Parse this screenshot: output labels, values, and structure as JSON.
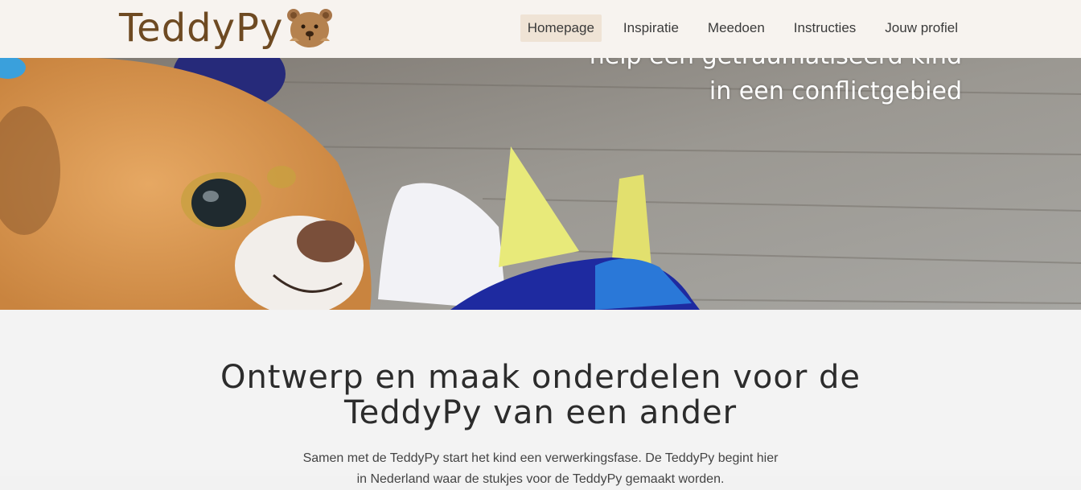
{
  "header": {
    "logo_text": "TeddyPy",
    "nav": [
      {
        "label": "Homepage",
        "active": true
      },
      {
        "label": "Inspiratie",
        "active": false
      },
      {
        "label": "Meedoen",
        "active": false
      },
      {
        "label": "Instructies",
        "active": false
      },
      {
        "label": "Jouw profiel",
        "active": false
      }
    ]
  },
  "hero": {
    "caption_line1": "help een getraumatiseerd kind",
    "caption_line2": "in een conflictgebied"
  },
  "main": {
    "title": "Ontwerp en maak onderdelen voor de TeddyPy van een ander",
    "intro": "Samen met de TeddyPy start het kind een verwerkingsfase. De TeddyPy begint hier in Nederland waar de stukjes voor de TeddyPy gemaakt worden."
  },
  "colors": {
    "header_bg": "#f7f3ef",
    "nav_active_bg": "#efe3d5",
    "logo_brown": "#6e4a22",
    "page_bg": "#f3f3f3"
  }
}
